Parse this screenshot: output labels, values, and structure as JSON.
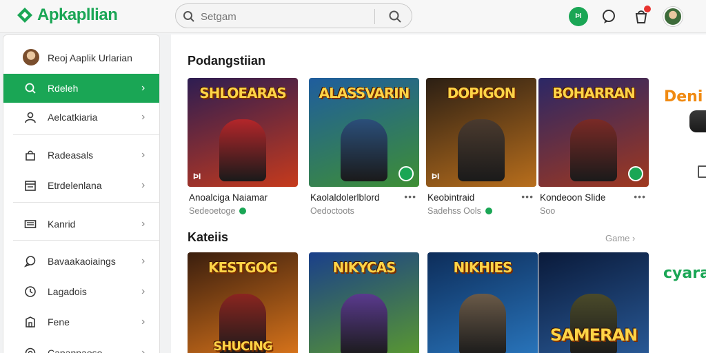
{
  "app": {
    "logo_text": "Apkapllian",
    "brand_color": "#1aa655"
  },
  "header": {
    "search_placeholder": "Setgam",
    "app_badge": "ÞI",
    "icons": [
      "chat-icon",
      "shopping-bag-icon",
      "avatar"
    ]
  },
  "sidebar": {
    "user_name": "Reoj Aaplik Urlarian",
    "items": [
      {
        "label": "Rdeleh",
        "icon": "search-icon",
        "active": true
      },
      {
        "label": "Aelcatkiaria",
        "icon": "user-icon",
        "active": false
      },
      {
        "label": "Radeasals",
        "icon": "bag-icon",
        "active": false
      },
      {
        "label": "Etrdelenlana",
        "icon": "calendar-icon",
        "active": false
      },
      {
        "label": "Kanrid",
        "icon": "keyboard-icon",
        "active": false
      },
      {
        "label": "Bavaakaoiaings",
        "icon": "chat-icon",
        "active": false
      },
      {
        "label": "Lagadois",
        "icon": "clock-icon",
        "active": false
      },
      {
        "label": "Fene",
        "icon": "store-icon",
        "active": false
      },
      {
        "label": "Capanpaoso",
        "icon": "settings-icon",
        "active": false
      }
    ]
  },
  "main": {
    "section1": {
      "title": "Podangstiian",
      "cards": [
        {
          "art_title": "SHLOEARAS",
          "badge": "ÞI",
          "name": "Anoalciga Naiamar",
          "sub": "Sedeoetoge",
          "verified": true,
          "more": false,
          "c1": "#2d1d52",
          "c2": "#c63a1c",
          "hero": "#b3262a"
        },
        {
          "art_title": "ALASSVARIN",
          "badge": "",
          "name": "Kaolaldolerlblord",
          "sub": "Oedoctoots",
          "verified": false,
          "more": true,
          "c1": "#1f5d9e",
          "c2": "#3e8f34",
          "hero": "#2b4f7a"
        },
        {
          "art_title": "DOPIGON",
          "badge": "ÞI",
          "name": "Keobintraid",
          "sub": "Sadehss Ools",
          "verified": true,
          "more": true,
          "c1": "#2b1f14",
          "c2": "#b86e1c",
          "hero": "#4a3a2e"
        },
        {
          "art_title": "BOHARRAN",
          "badge": "",
          "name": "Kondeoon Slide",
          "sub": "Soo",
          "verified": false,
          "more": true,
          "c1": "#2b2766",
          "c2": "#a0381f",
          "hero": "#7a2a26"
        }
      ]
    },
    "section2": {
      "title": "Kateiis",
      "see_more": "Game",
      "cards": [
        {
          "art_title": "KESTGOG",
          "bottom_title": "SHUCING",
          "c1": "#3a1e0e",
          "c2": "#e0781b",
          "hero": "#8a2520"
        },
        {
          "art_title": "NIKYCAS",
          "bottom_title": "",
          "c1": "#1a3f8a",
          "c2": "#5c9c2c",
          "hero": "#5a3a8e"
        },
        {
          "art_title": "NIKHIES",
          "bottom_title": "",
          "c1": "#0d2d5a",
          "c2": "#2a78c0",
          "hero": "#6a5a48"
        },
        {
          "art_title": "",
          "bottom_title": "SAMERAN",
          "c1": "#0a1a3a",
          "c2": "#2a5c9a",
          "hero": "#4a4a2a"
        }
      ]
    },
    "peek": {
      "top_text": "Deni",
      "bottom_text": "cyara"
    }
  }
}
